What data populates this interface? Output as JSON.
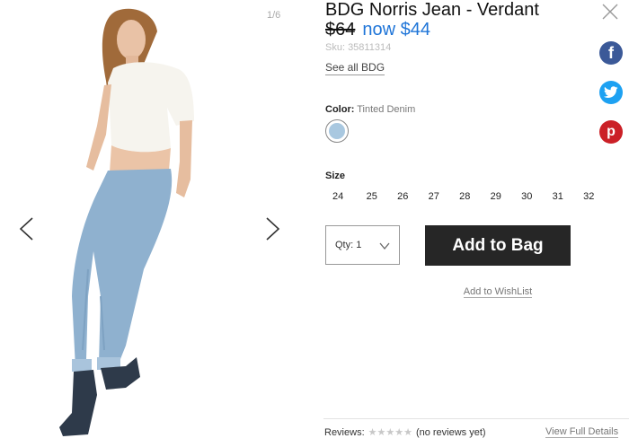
{
  "gallery": {
    "counter": "1/6"
  },
  "product": {
    "title": "BDG Norris Jean - Verdant",
    "price_old": "$64",
    "price_now": "now $44",
    "sku": "Sku: 35811314",
    "see_all": "See all BDG"
  },
  "color": {
    "label": "Color:",
    "value": "Tinted Denim",
    "swatch_color": "#a9c8e0"
  },
  "size": {
    "label": "Size",
    "options": [
      "24",
      "25",
      "26",
      "27",
      "28",
      "29",
      "30",
      "31",
      "32"
    ]
  },
  "purchase": {
    "qty_label": "Qty: 1",
    "add_to_bag": "Add to Bag",
    "wishlist": "Add to WishList"
  },
  "reviews": {
    "label": "Reviews:",
    "stars": "★★★★★",
    "rating": 0,
    "summary": "(no reviews yet)",
    "view_full": "View Full Details"
  },
  "social": {
    "facebook": "f",
    "twitter": "t",
    "pinterest": "p"
  },
  "colors": {
    "accent_price": "#1f75d8",
    "button_bg": "#262626",
    "facebook": "#3b5998",
    "twitter": "#1da1f2",
    "pinterest": "#cb2027"
  }
}
